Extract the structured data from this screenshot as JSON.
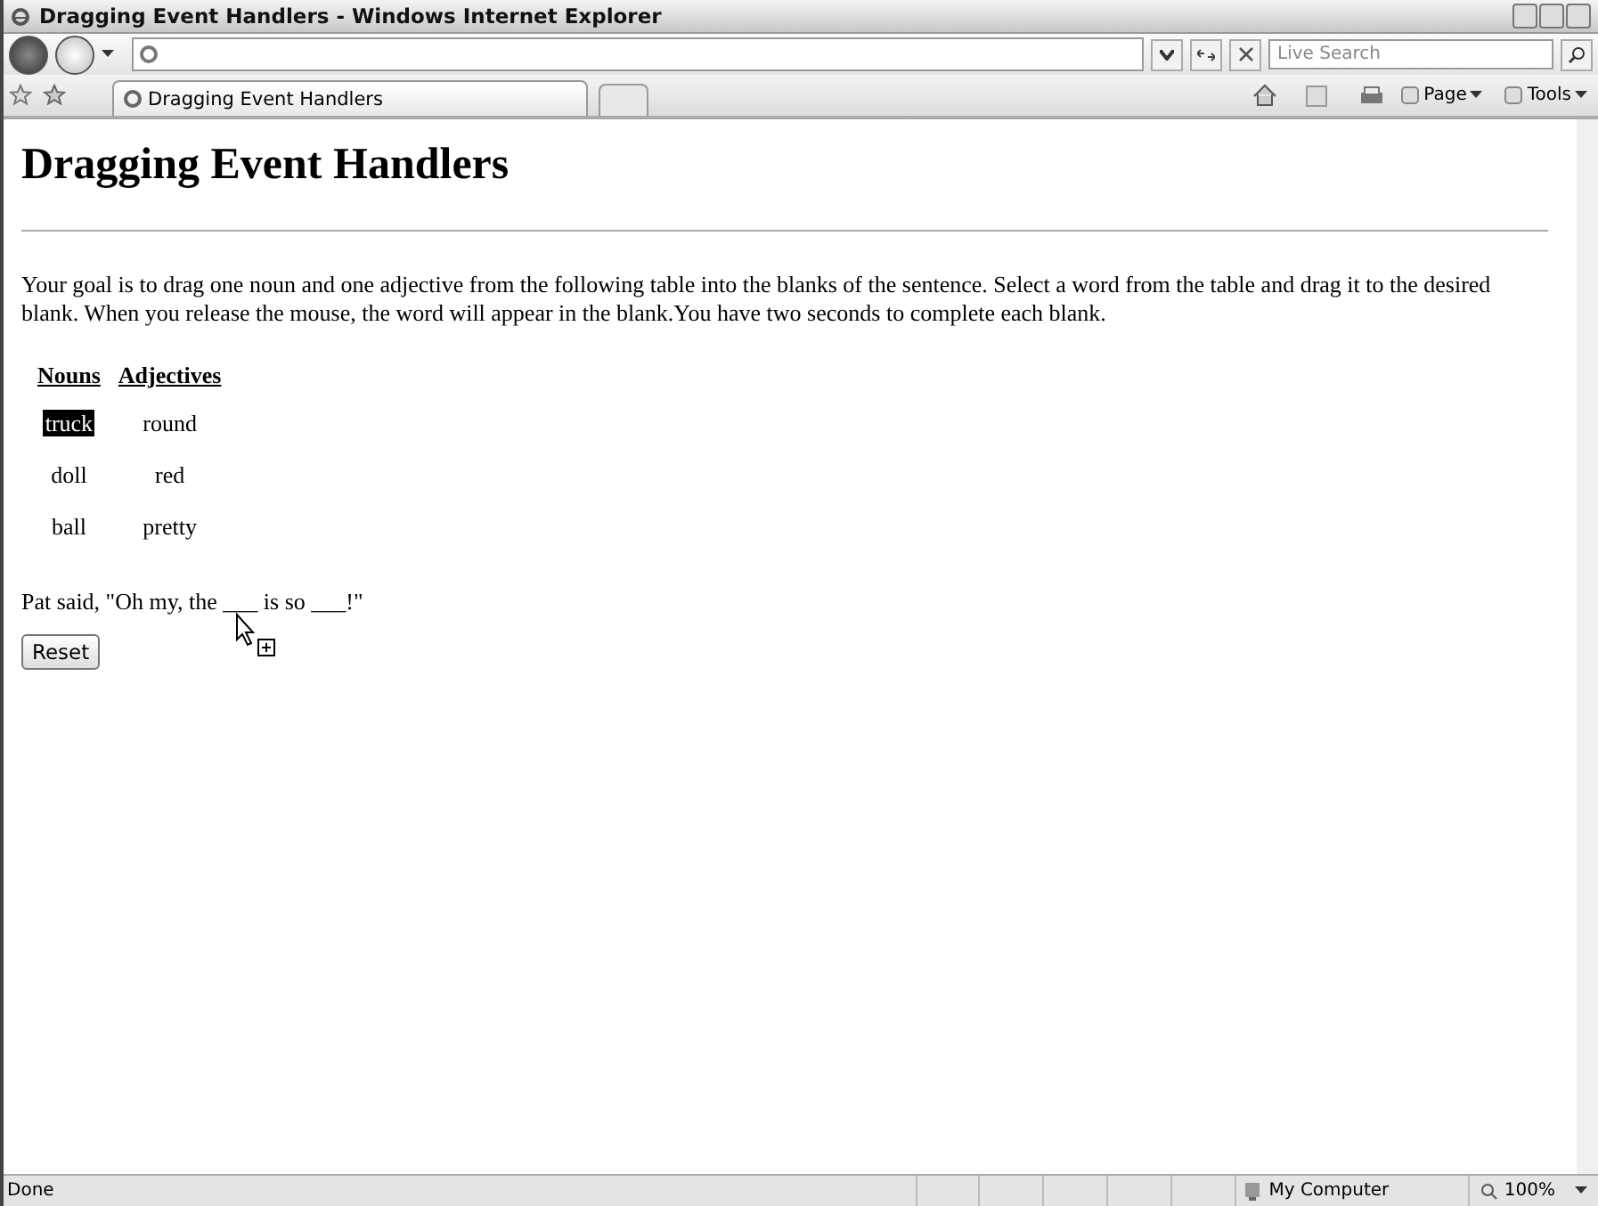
{
  "window": {
    "title": "Dragging Event Handlers - Windows Internet Explorer"
  },
  "search": {
    "placeholder": "Live Search"
  },
  "tab": {
    "label": "Dragging Event Handlers"
  },
  "command_bar": [
    {
      "label": "Page"
    },
    {
      "label": "Tools"
    }
  ],
  "page": {
    "heading": "Dragging Event Handlers",
    "intro": "Your goal is to drag one noun and one adjective from the following table into the blanks of the sentence. Select a word from the table and drag it to the desired blank. When you release the mouse, the word will appear in the blank.You have two seconds to complete each blank.",
    "table": {
      "columns": [
        "Nouns",
        "Adjectives"
      ],
      "rows": [
        [
          {
            "text": "truck",
            "selected": true
          },
          {
            "text": "round",
            "selected": false
          }
        ],
        [
          {
            "text": "doll",
            "selected": false
          },
          {
            "text": "red",
            "selected": false
          }
        ],
        [
          {
            "text": "ball",
            "selected": false
          },
          {
            "text": "pretty",
            "selected": false
          }
        ]
      ]
    },
    "sentence": "Pat said, \"Oh my, the ___ is so ___!\"",
    "reset_button": "Reset"
  },
  "status_bar": {
    "status": "Done",
    "zone": "My Computer",
    "zoom": "100%"
  }
}
